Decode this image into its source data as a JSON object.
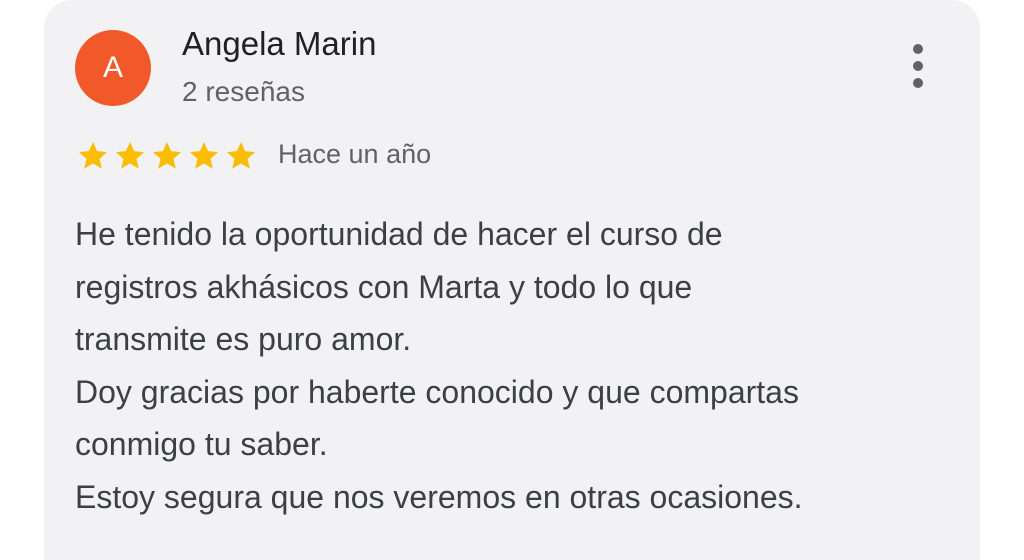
{
  "review": {
    "avatar_letter": "A",
    "avatar_color": "#f1592a",
    "author_name": "Angela Marin",
    "review_count": "2 reseñas",
    "rating": 5,
    "rating_max": 5,
    "star_color": "#fbbc04",
    "time_ago": "Hace un año",
    "more_icon": "more-vertical-icon",
    "text_lines": [
      "He tenido la oportunidad de hacer el curso de",
      "registros akhásicos con Marta y todo lo que",
      "transmite es puro amor.",
      "Doy gracias por haberte conocido y que compartas",
      "conmigo tu saber.",
      "Estoy segura que nos veremos en otras ocasiones."
    ]
  }
}
